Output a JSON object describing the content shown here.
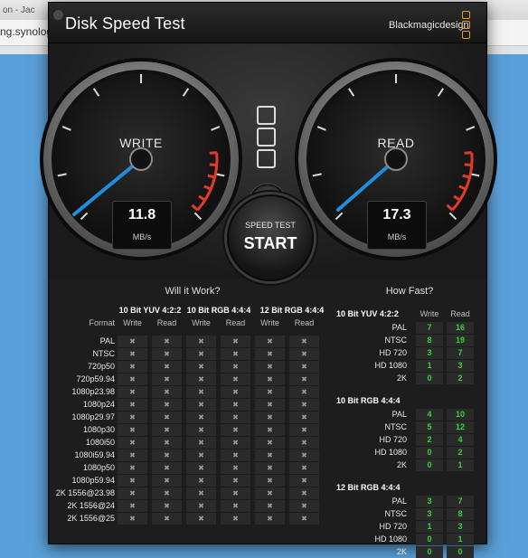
{
  "browser": {
    "tab_text": "on - Jac",
    "url_text": "ng.synology"
  },
  "app": {
    "title": "Disk Speed Test",
    "brand": "Blackmagicdesign"
  },
  "colors": {
    "needle": "#1e8fe0",
    "redline": "#e03b2a",
    "ok_value": "#35d435",
    "brand_accent": "#e8a02a"
  },
  "write_gauge": {
    "label": "WRITE",
    "value": "11.8",
    "unit": "MB/s"
  },
  "read_gauge": {
    "label": "READ",
    "value": "17.3",
    "unit": "MB/s"
  },
  "start_button": {
    "small": "SPEED TEST",
    "big": "START"
  },
  "icons": {
    "settings": "gear-icon",
    "status": "x-mark-icon"
  },
  "will_it_work": {
    "heading": "Will it Work?",
    "format_header": "Format",
    "groups": [
      "10 Bit YUV 4:2:2",
      "10 Bit RGB 4:4:4",
      "12 Bit RGB 4:4:4"
    ],
    "sub_headers": [
      "Write",
      "Read",
      "Write",
      "Read",
      "Write",
      "Read"
    ],
    "mark": "✖",
    "formats": [
      "PAL",
      "NTSC",
      "720p50",
      "720p59.94",
      "1080p23.98",
      "1080p24",
      "1080p29.97",
      "1080p30",
      "1080i50",
      "1080i59.94",
      "1080p50",
      "1080p59.94",
      "2K 1556@23.98",
      "2K 1556@24",
      "2K 1556@25"
    ]
  },
  "how_fast": {
    "heading": "How Fast?",
    "sub_headers": [
      "Write",
      "Read"
    ],
    "groups": [
      {
        "name": "10 Bit YUV 4:2:2",
        "rows": [
          {
            "format": "PAL",
            "write": "7",
            "read": "16"
          },
          {
            "format": "NTSC",
            "write": "8",
            "read": "19"
          },
          {
            "format": "HD 720",
            "write": "3",
            "read": "7"
          },
          {
            "format": "HD 1080",
            "write": "1",
            "read": "3"
          },
          {
            "format": "2K",
            "write": "0",
            "read": "2"
          }
        ]
      },
      {
        "name": "10 Bit RGB 4:4:4",
        "rows": [
          {
            "format": "PAL",
            "write": "4",
            "read": "10"
          },
          {
            "format": "NTSC",
            "write": "5",
            "read": "12"
          },
          {
            "format": "HD 720",
            "write": "2",
            "read": "4"
          },
          {
            "format": "HD 1080",
            "write": "0",
            "read": "2"
          },
          {
            "format": "2K",
            "write": "0",
            "read": "1"
          }
        ]
      },
      {
        "name": "12 Bit RGB 4:4:4",
        "rows": [
          {
            "format": "PAL",
            "write": "3",
            "read": "7"
          },
          {
            "format": "NTSC",
            "write": "3",
            "read": "8"
          },
          {
            "format": "HD 720",
            "write": "1",
            "read": "3"
          },
          {
            "format": "HD 1080",
            "write": "0",
            "read": "1"
          },
          {
            "format": "2K",
            "write": "0",
            "read": "0"
          }
        ]
      }
    ]
  }
}
